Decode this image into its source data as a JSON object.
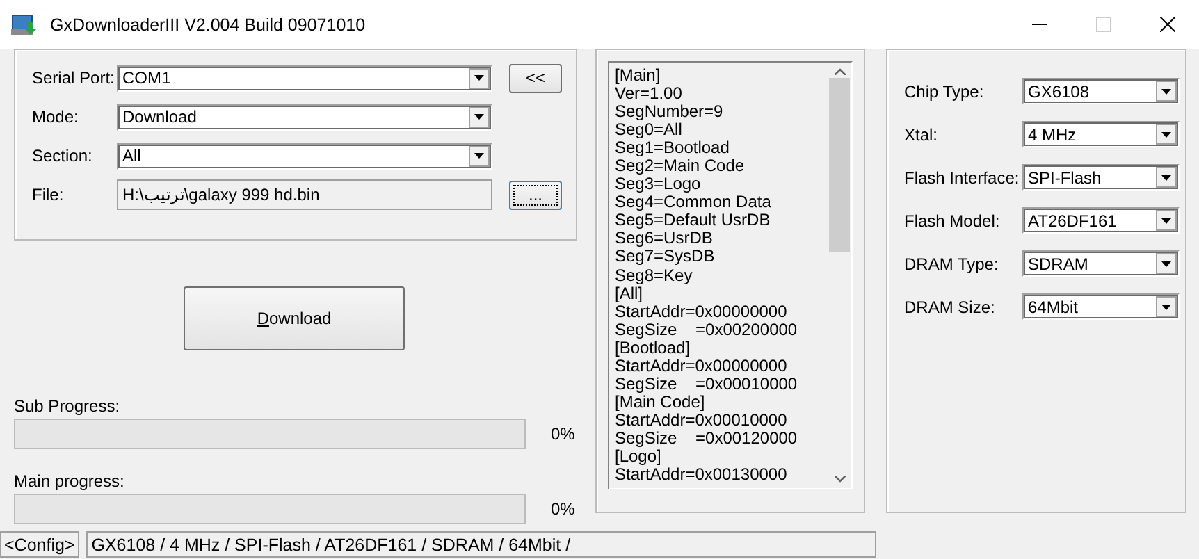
{
  "window": {
    "title": "GxDownloaderIII V2.004 Build 09071010"
  },
  "port_group": {
    "fields": [
      {
        "label": "Serial Port:",
        "kind": "dropdown",
        "value": "COM1"
      },
      {
        "label": "Mode:",
        "kind": "dropdown",
        "value": "Download"
      },
      {
        "label": "Section:",
        "kind": "dropdown",
        "value": "All"
      },
      {
        "label": "File:",
        "kind": "readonly",
        "value": "H:\\ترتيب\\galaxy 999 hd.bin"
      }
    ],
    "collapse_button": {
      "label": "<<",
      "focused": false
    },
    "browse_button": {
      "label": "...",
      "focused": true
    }
  },
  "download_button": {
    "label": "Download",
    "first_letter_underlined": true
  },
  "progress": [
    {
      "label": "Sub Progress:",
      "level": 0,
      "reading": "0%"
    },
    {
      "label": "Main progress:",
      "level": 0,
      "reading": "0%"
    }
  ],
  "config_text": {
    "lines": [
      "[Main]",
      "Ver=1.00",
      "SegNumber=9",
      "Seg0=All",
      "Seg1=Bootload",
      "Seg2=Main Code",
      "Seg3=Logo",
      "Seg4=Common Data",
      "Seg5=Default UsrDB",
      "Seg6=UsrDB",
      "Seg7=SysDB",
      "Seg8=Key",
      "[All]",
      "StartAddr=0x00000000",
      "SegSize    =0x00200000",
      "[Bootload]",
      "StartAddr=0x00000000",
      "SegSize    =0x00010000",
      "[Main Code]",
      "StartAddr=0x00010000",
      "SegSize    =0x00120000",
      "[Logo]",
      "StartAddr=0x00130000"
    ]
  },
  "chip_group": {
    "fields": [
      {
        "label": "Chip Type:",
        "value": "GX6108"
      },
      {
        "label": "Xtal:",
        "value": "4 MHz"
      },
      {
        "label": "Flash Interface:",
        "value": "SPI-Flash"
      },
      {
        "label": "Flash Model:",
        "value": "AT26DF161"
      },
      {
        "label": "DRAM Type:",
        "value": "SDRAM"
      },
      {
        "label": "DRAM Size:",
        "value": "64Mbit"
      }
    ]
  },
  "status_bar": {
    "tag": "<Config>",
    "text": "GX6108 / 4 MHz / SPI-Flash / AT26DF161 / SDRAM / 64Mbit /"
  }
}
